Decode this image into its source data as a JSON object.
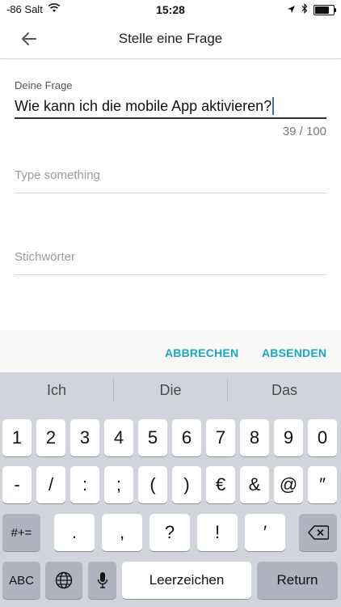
{
  "status_bar": {
    "carrier": "-86 Salt",
    "time": "15:28",
    "battery_level": 0.85,
    "icons": [
      "wifi-icon",
      "location-arrow-icon",
      "bluetooth-icon",
      "battery-icon"
    ]
  },
  "header": {
    "title": "Stelle eine Frage",
    "back_icon": "back-arrow-icon"
  },
  "form": {
    "question_label": "Deine Frage",
    "question_value": "Wie kann ich die mobile App aktivieren?",
    "char_count": "39 / 100",
    "details_placeholder": "Type something",
    "tags_placeholder": "Stichwörter"
  },
  "actions": {
    "cancel": "ABBRECHEN",
    "submit": "ABSENDEN",
    "accent_color": "#1aa6c9"
  },
  "keyboard": {
    "suggestions": [
      "Ich",
      "Die",
      "Das"
    ],
    "row1": [
      "1",
      "2",
      "3",
      "4",
      "5",
      "6",
      "7",
      "8",
      "9",
      "0"
    ],
    "row2": [
      "-",
      "/",
      ":",
      ";",
      "(",
      ")",
      "€",
      "&",
      "@",
      "″"
    ],
    "row3_left": "#+=",
    "row3": [
      ".",
      ",",
      "?",
      "!",
      "′"
    ],
    "abc": "ABC",
    "space": "Leerzeichen",
    "return": "Return"
  }
}
